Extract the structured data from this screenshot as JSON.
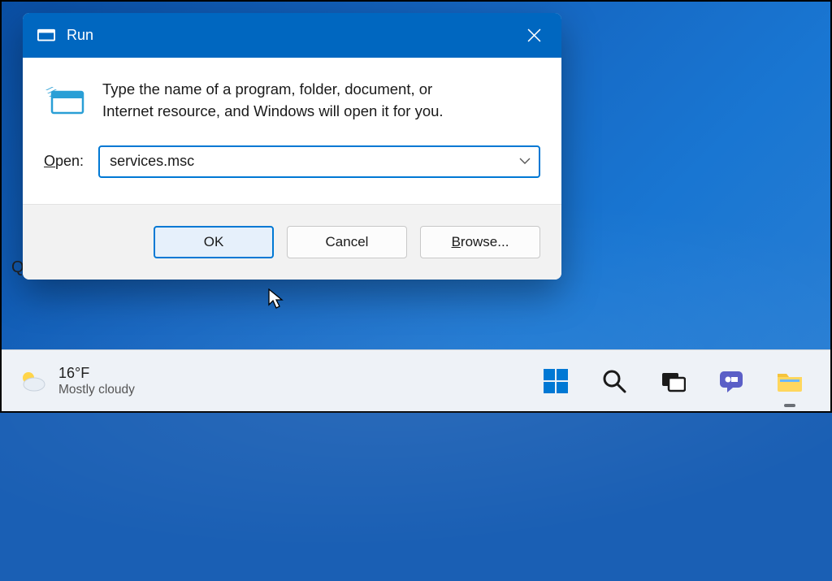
{
  "dialog": {
    "title": "Run",
    "description_line1": "Type the name of a program, folder, document, or",
    "description_line2": "Internet resource, and Windows will open it for you.",
    "open_label_underline": "O",
    "open_label_rest": "pen:",
    "input_value": "services.msc",
    "buttons": {
      "ok": "OK",
      "cancel": "Cancel",
      "browse_underline": "B",
      "browse_rest": "rowse..."
    }
  },
  "taskbar": {
    "weather": {
      "temp": "16°F",
      "condition": "Mostly cloudy"
    }
  },
  "fragment": {
    "q": "Q"
  }
}
